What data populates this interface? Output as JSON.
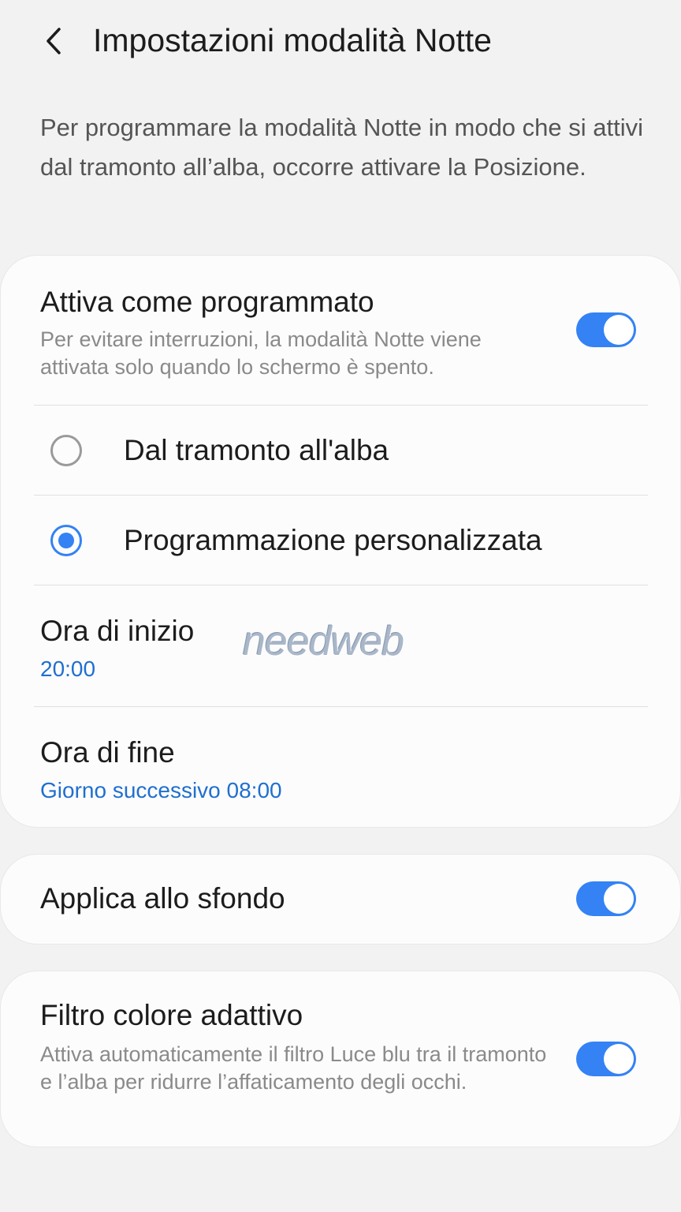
{
  "header": {
    "title": "Impostazioni modalità Notte"
  },
  "intro": "Per programmare la modalità Notte in modo che si attivi dal tramonto all’alba, occorre attivare la Posizione.",
  "schedule_card": {
    "scheduled": {
      "title": "Attiva come programmato",
      "subtitle": "Per evitare interruzioni, la modalità Notte viene attivata solo quando lo schermo è spento.",
      "enabled": true
    },
    "options": [
      {
        "label": "Dal tramonto all'alba",
        "selected": false
      },
      {
        "label": "Programmazione personalizzata",
        "selected": true
      }
    ],
    "start": {
      "label": "Ora di inizio",
      "value": "20:00"
    },
    "end": {
      "label": "Ora di fine",
      "value": "Giorno successivo 08:00"
    }
  },
  "wallpaper": {
    "title": "Applica allo sfondo",
    "enabled": true
  },
  "adaptive_filter": {
    "title": "Filtro colore adattivo",
    "subtitle": "Attiva automaticamente il filtro Luce blu tra il tramonto e l’alba per ridurre l’affaticamento degli occhi.",
    "enabled": true
  },
  "watermark": "needweb",
  "colors": {
    "accent": "#3482f4",
    "value_text": "#1f6fd0",
    "background": "#f2f2f2",
    "card": "#fcfcfc"
  },
  "icons": {
    "back": "chevron-left-icon"
  }
}
